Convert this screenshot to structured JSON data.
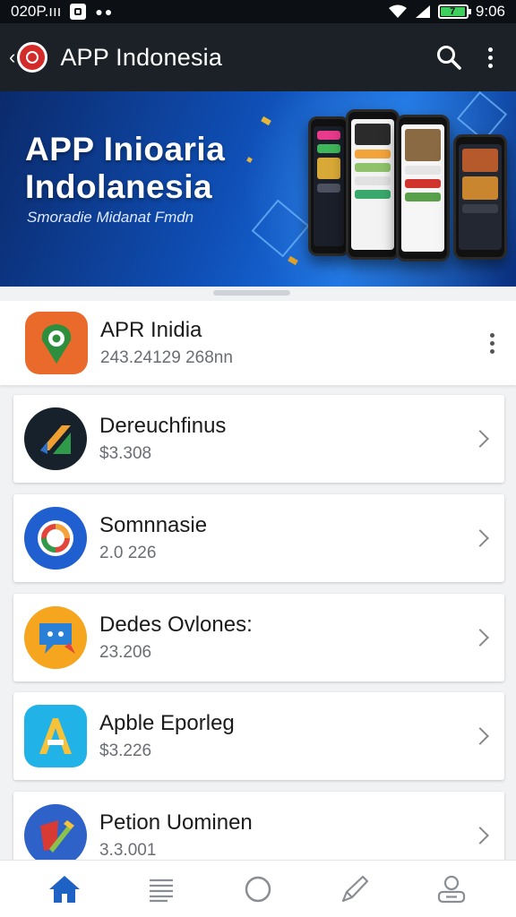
{
  "status_bar": {
    "carrier": "020P.ııı",
    "battery_label": "7",
    "time": "9:06",
    "battery_level": 0.95
  },
  "app_bar": {
    "title": "APP Indonesia",
    "back_icon": "back-arrow-icon",
    "logo_icon": "app-logo-icon",
    "search_icon": "search-icon",
    "menu_icon": "more-vert-icon"
  },
  "banner": {
    "headline_line1": "APP Inioaria",
    "headline_line2": "Indolanesia",
    "subtitle": "Smoradie Midanat Fmdn"
  },
  "featured": {
    "name": "APR Inidia",
    "detail": "243.24129 268nn",
    "icon": "map-pin-icon"
  },
  "apps": [
    {
      "name": "Dereuchfinus",
      "detail": "$3.308",
      "icon": "slash-logo-icon"
    },
    {
      "name": "Somnnasie",
      "detail": "2.0 226",
      "icon": "ring-logo-icon"
    },
    {
      "name": "Dedes Ovlones:",
      "detail": "23.206",
      "icon": "chat-bubble-icon"
    },
    {
      "name": "Apble Eporleg",
      "detail": "$3.226",
      "icon": "letter-a-icon"
    },
    {
      "name": "Petion Uominen",
      "detail": "3.3.001",
      "icon": "pencil-logo-icon"
    }
  ],
  "bottom_nav": [
    {
      "icon": "home-icon",
      "active": true
    },
    {
      "icon": "list-icon",
      "active": false
    },
    {
      "icon": "circle-icon",
      "active": false
    },
    {
      "icon": "pen-icon",
      "active": false
    },
    {
      "icon": "profile-icon",
      "active": false
    }
  ],
  "colors": {
    "accent": "#1f62c6",
    "app_bar": "#1c2027",
    "banner": "#0f4fb6"
  }
}
